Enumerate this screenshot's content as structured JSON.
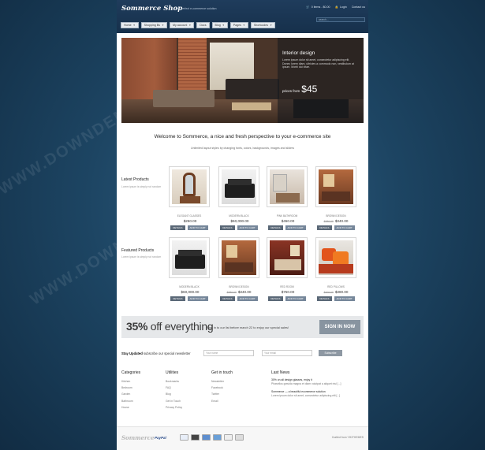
{
  "header": {
    "logo": "Sommerce Shop",
    "tagline": "The perfect e-commerce solution",
    "cart": "0 items - $0.00",
    "login": "Login",
    "contact": "Contact us",
    "search_placeholder": "search..."
  },
  "nav": [
    {
      "label": "Home",
      "dropdown": true
    },
    {
      "label": "Shopping Bs",
      "dropdown": true
    },
    {
      "label": "My account",
      "dropdown": true
    },
    {
      "label": "Docs",
      "dropdown": false
    },
    {
      "label": "Blog",
      "dropdown": true
    },
    {
      "label": "Pages",
      "dropdown": true
    },
    {
      "label": "Shortcodes",
      "dropdown": true
    }
  ],
  "hero": {
    "title": "Interior design",
    "text": "Lorem ipsum dolor sit amet, consectetur adipiscing elit. Donec lorem diam, ultricies a commodo non, vestibulum at ipsum. Morbi dui vitae.",
    "price_prefix": "prices from",
    "price": "$45"
  },
  "welcome": {
    "title": "Welcome to Sommerce, a nice and fresh perspective to your e-commerce site",
    "subtitle": "Unlimited layout styles by changing fonts, colors, backgrounds, images and sliders"
  },
  "latest": {
    "title": "Latest Products",
    "subtitle": "Lorem ipsum is simply not random",
    "items": [
      {
        "name": "ELEGANT GLASSES",
        "price": "$250.00",
        "old_price": "",
        "image": "mirror"
      },
      {
        "name": "MODERN BLACK",
        "price": "$60,000.00",
        "old_price": "",
        "image": "black-sofa"
      },
      {
        "name": "PINK BATHROOM",
        "price": "$450.00",
        "old_price": "",
        "image": "bathroom"
      },
      {
        "name": "BROWN DESIGN",
        "price": "$340.00",
        "old_price": "$380.00",
        "image": "brown-room"
      }
    ]
  },
  "featured": {
    "title": "Featured Products",
    "subtitle": "Lorem ipsum is simply not random",
    "items": [
      {
        "name": "MODERN BLACK",
        "price": "$60,000.00",
        "old_price": "",
        "image": "black-sofa"
      },
      {
        "name": "BROWN DESIGN",
        "price": "$340.00",
        "old_price": "$380.00",
        "image": "brown-room"
      },
      {
        "name": "RED ROOM",
        "price": "$750.00",
        "old_price": "",
        "image": "red-room"
      },
      {
        "name": "RED PILLOWS",
        "price": "$380.00",
        "old_price": "$400.00",
        "image": "pillows"
      }
    ],
    "details_label": "DETAILS",
    "add_label": "ADD TO CART"
  },
  "promo": {
    "percent": "35%",
    "rest": "off everything",
    "text": "Sign in to our list before march 22 to enjoy our special sales!",
    "button": "SIGN IN NOW"
  },
  "newsletter": {
    "title": "Stay Updated",
    "text": "subscribe our special newsletter",
    "name_placeholder": "Your name",
    "email_placeholder": "Your email",
    "button": "Subscribe"
  },
  "footer": {
    "categories": {
      "title": "Categories",
      "items": [
        "Kitchen",
        "Bedroom",
        "Garden",
        "Bathroom",
        "House"
      ]
    },
    "utilities": {
      "title": "Utilities",
      "items": [
        "Bookmarks",
        "FAQ",
        "Blog",
        "Get in Touch",
        "Privacy Policy"
      ]
    },
    "touch": {
      "title": "Get in touch",
      "items": [
        "Newsletter",
        "Facebook",
        "Twitter",
        "Email"
      ]
    },
    "news": {
      "title": "Last News",
      "items": [
        {
          "title": "30% on all design glasses, enjoy it",
          "desc": "Phasellus gravida magna et diam volutpat a aliquet nisl [...]"
        },
        {
          "title": "Sommerce — a beautiful ecommerce solution",
          "desc": "Lorem ipsum dolor sit amet, consectetur adipiscing elit [...]"
        }
      ]
    }
  },
  "bottom": {
    "logo": "Sommerce",
    "paypal": "PayPal",
    "credit": "Crafted from YIKITHEMES"
  },
  "colors": {
    "header": "#1a3652",
    "accent_button": "#8894a0",
    "background": "#1d4563"
  }
}
